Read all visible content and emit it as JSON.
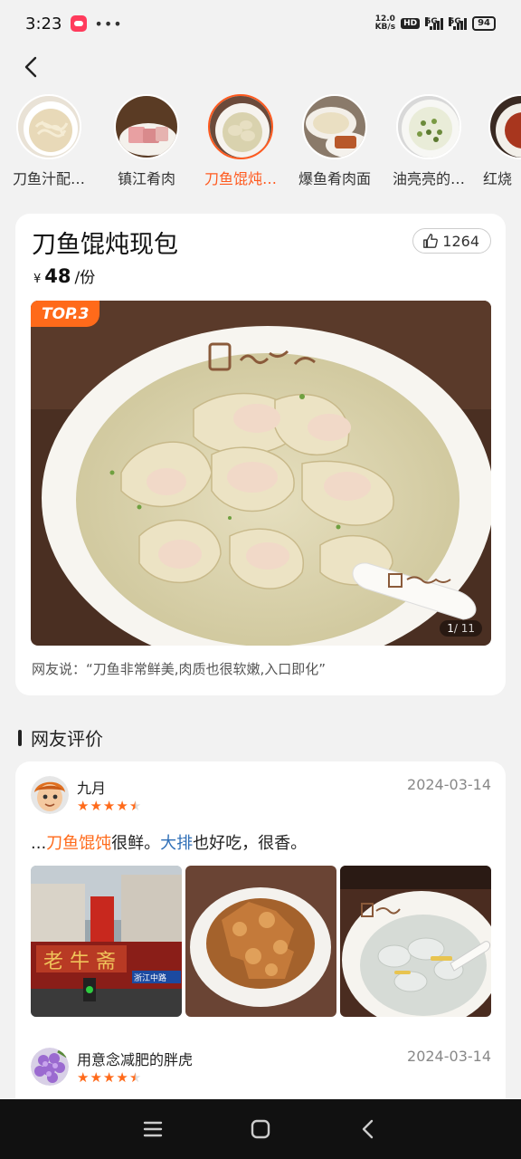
{
  "status_bar": {
    "time": "3:23",
    "net_speed_top": "12.0",
    "net_speed_bottom": "KB/s",
    "hd": "HD",
    "sig1": "5G",
    "sig2": "5G",
    "battery": "94"
  },
  "categories": [
    {
      "label": "刀鱼汁配…",
      "active": false
    },
    {
      "label": "镇江肴肉",
      "active": false
    },
    {
      "label": "刀鱼馄炖…",
      "active": true
    },
    {
      "label": "爆鱼肴肉面",
      "active": false
    },
    {
      "label": "油亮亮的…",
      "active": false
    },
    {
      "label": "红烧",
      "active": false
    }
  ],
  "dish": {
    "name": "刀鱼馄炖现包",
    "likes": "1264",
    "currency": "¥",
    "price": "48",
    "unit": "/份",
    "badge": "TOP.3",
    "photo_counter_current": "1",
    "photo_counter_total": "/ 11",
    "quote": "网友说：“刀鱼非常鲜美,肉质也很软嫩,入口即化”"
  },
  "reviews_section": {
    "title": "网友评价"
  },
  "reviews": [
    {
      "user": "九月",
      "date": "2024-03-14",
      "rating": 4.5,
      "text_prefix": "...",
      "text_hl1": "刀鱼馄饨",
      "text_mid": "很鲜。",
      "text_hl2": "大排",
      "text_suffix": "也好吃，很香。",
      "photo_sign_text": "浙江中路"
    },
    {
      "user": "用意念减肥的胖虎",
      "date": "2024-03-14",
      "rating": 4.5
    }
  ],
  "colors": {
    "accent": "#ff6a1a",
    "link_blue": "#2f6fb7"
  }
}
